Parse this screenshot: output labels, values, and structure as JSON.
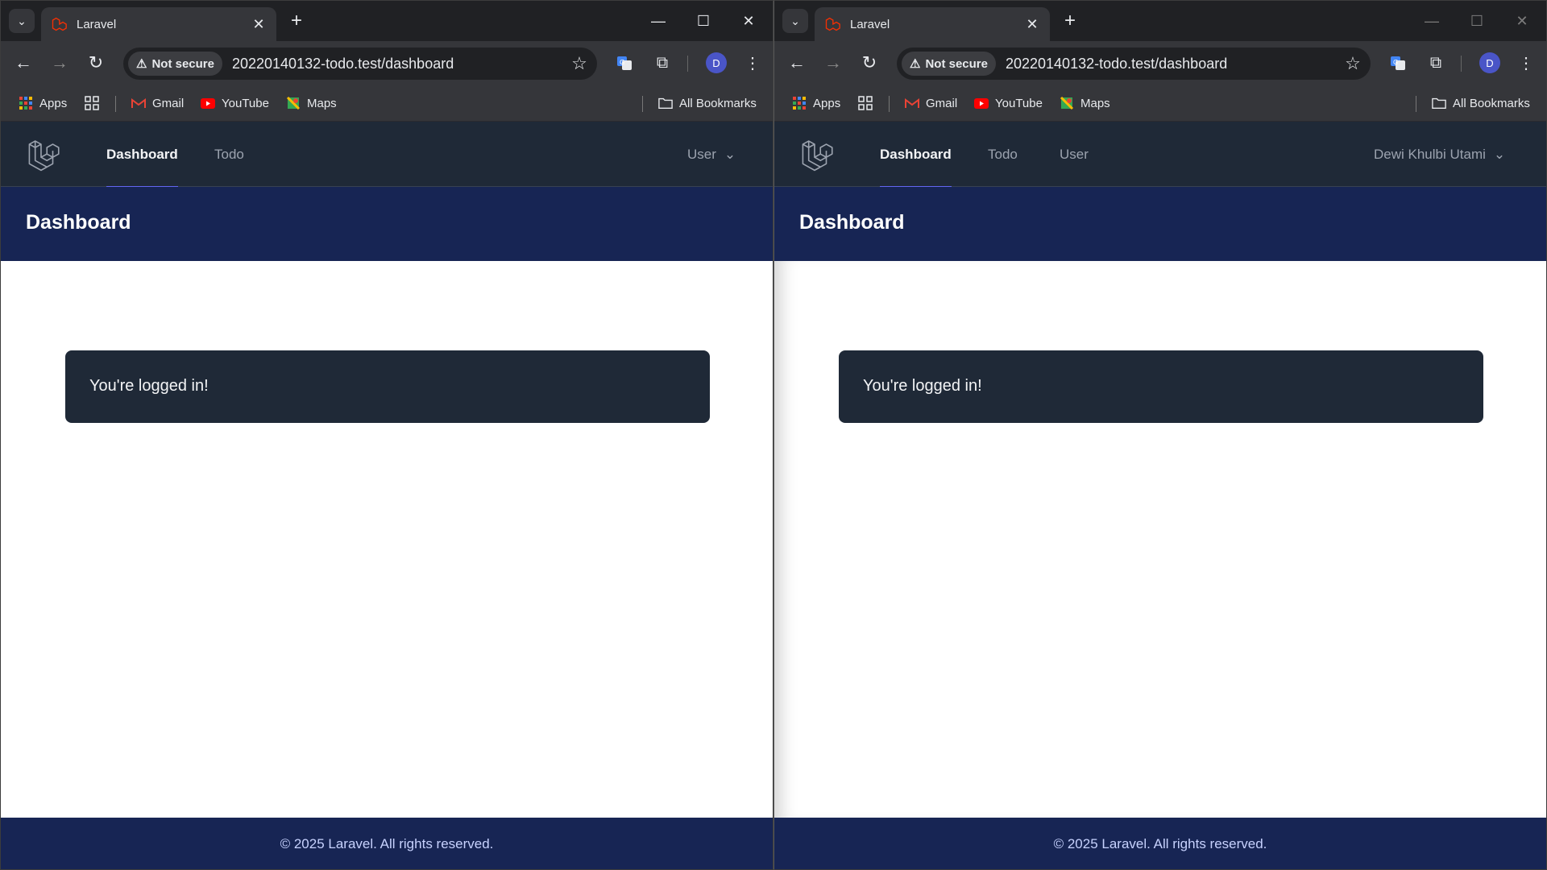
{
  "windows": [
    {
      "tab_title": "Laravel",
      "security_label": "Not secure",
      "url": "20220140132-todo.test/dashboard",
      "profile_initial": "D",
      "bookmarks": {
        "apps": "Apps",
        "gmail": "Gmail",
        "youtube": "YouTube",
        "maps": "Maps",
        "all": "All Bookmarks"
      },
      "nav": {
        "dashboard": "Dashboard",
        "todo": "Todo",
        "user_menu": "User"
      },
      "header_title": "Dashboard",
      "card_text": "You're logged in!",
      "footer_text": "© 2025 Laravel. All rights reserved."
    },
    {
      "tab_title": "Laravel",
      "security_label": "Not secure",
      "url": "20220140132-todo.test/dashboard",
      "profile_initial": "D",
      "bookmarks": {
        "apps": "Apps",
        "gmail": "Gmail",
        "youtube": "YouTube",
        "maps": "Maps",
        "all": "All Bookmarks"
      },
      "nav": {
        "dashboard": "Dashboard",
        "todo": "Todo",
        "user": "User",
        "user_menu": "Dewi Khulbi Utami"
      },
      "header_title": "Dashboard",
      "card_text": "You're logged in!",
      "footer_text": "© 2025 Laravel. All rights reserved."
    }
  ],
  "colors": {
    "nav_bg": "#1f2937",
    "header_bg": "#172554",
    "card_bg": "#1f2937",
    "active_underline": "#6366f1",
    "laravel_red": "#f53003"
  },
  "icons": {
    "tab_search": "chevron-down-icon",
    "favicon": "laravel-logo-icon",
    "app_logo": "laravel-logo-icon",
    "dropdown": "chevron-down-icon"
  }
}
